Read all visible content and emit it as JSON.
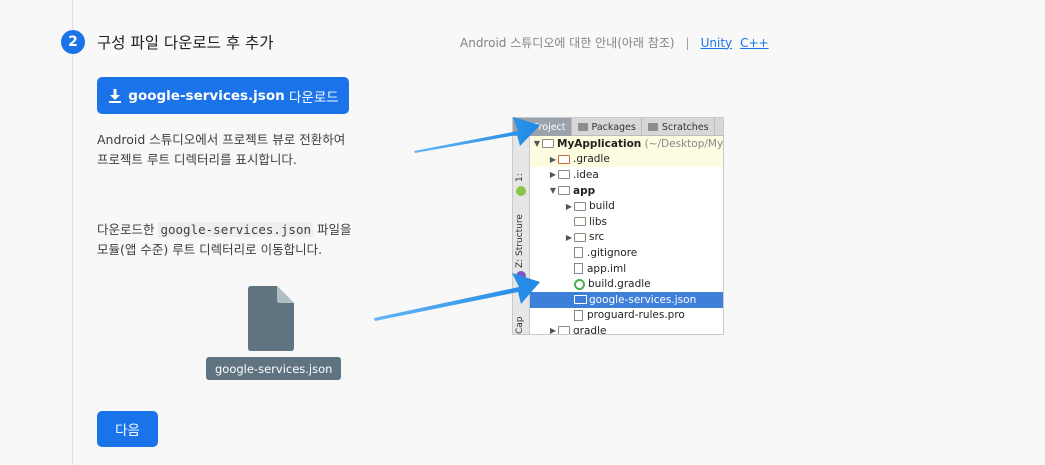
{
  "step": {
    "number": "2",
    "title": "구성 파일 다운로드 후 추가"
  },
  "header": {
    "guide_text": "Android 스튜디오에 대한 안내(아래 참조)",
    "separator": "|",
    "links": [
      "Unity",
      "C++"
    ]
  },
  "download_button": {
    "filename": "google-services.json",
    "suffix": " 다운로드"
  },
  "instruction1": {
    "line1": "Android 스튜디오에서 프로젝트 뷰로 전환하여",
    "line2": "프로젝트 루트 디렉터리를 표시합니다."
  },
  "instruction2": {
    "prefix": "다운로드한 ",
    "code": "google-services.json",
    "suffix": " 파일을",
    "line2": "모듈(앱 수준) 루트 디렉터리로 이동합니다."
  },
  "file_card": {
    "label": "google-services.json"
  },
  "next_button": {
    "label": "다음"
  },
  "ide": {
    "tabs": [
      "Project",
      "Packages",
      "Scratches"
    ],
    "side_tabs": [
      "1:",
      "Z: Structure",
      "Cap"
    ],
    "tree": [
      {
        "name": "MyApplication",
        "extra": " (~/Desktop/My",
        "indent": 0,
        "arrow": "▼",
        "icon": "module"
      },
      {
        "name": ".gradle",
        "indent": 1,
        "arrow": "▶",
        "icon": "folder-red"
      },
      {
        "name": ".idea",
        "indent": 1,
        "arrow": "▶",
        "icon": "folder"
      },
      {
        "name": "app",
        "indent": 1,
        "arrow": "▼",
        "icon": "module"
      },
      {
        "name": "build",
        "indent": 2,
        "arrow": "▶",
        "icon": "folder"
      },
      {
        "name": "libs",
        "indent": 2,
        "arrow": "",
        "icon": "folder"
      },
      {
        "name": "src",
        "indent": 2,
        "arrow": "▶",
        "icon": "folder"
      },
      {
        "name": ".gitignore",
        "indent": 2,
        "arrow": "",
        "icon": "file"
      },
      {
        "name": "app.iml",
        "indent": 2,
        "arrow": "",
        "icon": "file"
      },
      {
        "name": "build.gradle",
        "indent": 2,
        "arrow": "",
        "icon": "gradle"
      },
      {
        "name": "google-services.json",
        "indent": 2,
        "arrow": "",
        "icon": "json",
        "selected": true
      },
      {
        "name": "proguard-rules.pro",
        "indent": 2,
        "arrow": "",
        "icon": "file"
      },
      {
        "name": "gradle",
        "indent": 1,
        "arrow": "▶",
        "icon": "folder"
      }
    ]
  },
  "colors": {
    "primary": "#1a73e8",
    "arrow": "#1e88e5",
    "selection": "#3d7fd9"
  }
}
